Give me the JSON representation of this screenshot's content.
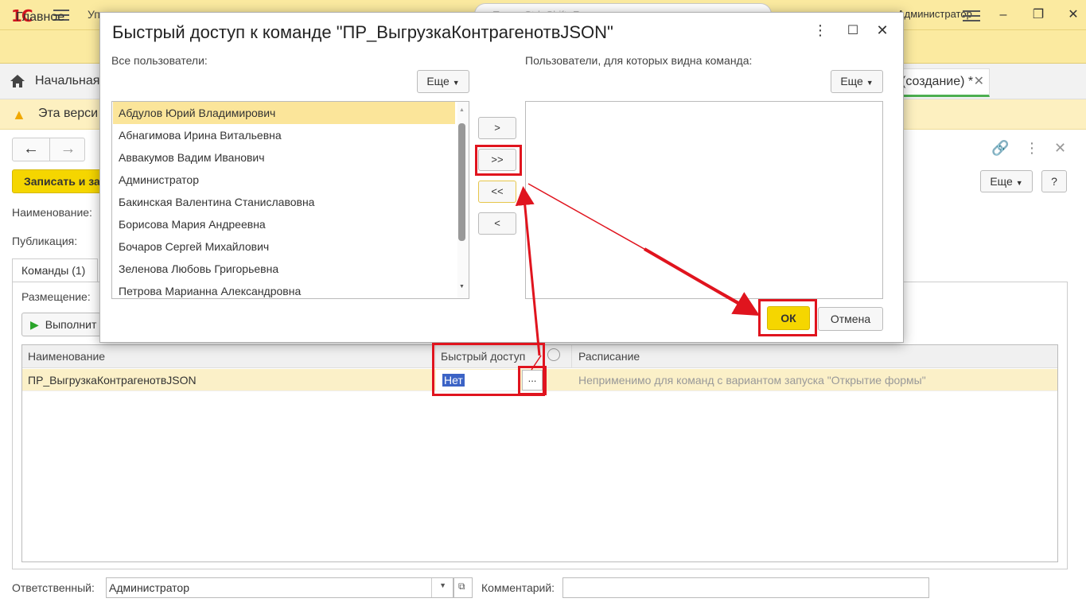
{
  "topbar": {
    "logo": "1С",
    "app_title": "Уп",
    "search_placeholder": "Поиск Ctrl+Shift+F",
    "user": "Администратор",
    "win_minimize": "–",
    "win_restore": "❐",
    "win_close": "✕"
  },
  "sections": {
    "main": "Главное"
  },
  "tabs": {
    "home": "Начальная",
    "active": "(создание) *",
    "active_close": "✕"
  },
  "warning": {
    "text": "Эта верси"
  },
  "form": {
    "nav_back": "←",
    "nav_forward": "→",
    "save_label": "Записать и за",
    "more_label": "Еще",
    "help_label": "?",
    "name_label": "Наименование:",
    "publication_label": "Публикация:",
    "commands_tab": "Команды (1)",
    "placement_label": "Размещение:",
    "run_label": "Выполнит",
    "grid": {
      "columns": [
        "Наименование",
        "Быстрый доступ",
        "Расписание"
      ],
      "rows": [
        {
          "name": "ПР_ВыгрузкаКонтрагенотвJSON",
          "quick_access": "Нет",
          "schedule": "Неприменимо для команд с вариантом запуска \"Открытие формы\""
        }
      ],
      "dots": "..."
    },
    "responsible_label": "Ответственный:",
    "responsible_value": "Администратор",
    "comment_label": "Комментарий:",
    "comment_value": ""
  },
  "dialog": {
    "title": "Быстрый доступ к команде \"ПР_ВыгрузкаКонтрагенотвJSON\"",
    "all_users_label": "Все пользователи:",
    "visible_users_label": "Пользователи, для которых видна команда:",
    "more_label": "Еще",
    "users": [
      "Абдулов Юрий Владимирович",
      "Абнагимова Ирина Витальевна",
      "Аввакумов Вадим Иванович",
      "Администратор",
      "Бакинская Валентина Станиславовна",
      "Борисова Мария Андреевна",
      "Бочаров Сергей Михайлович",
      "Зеленова Любовь Григорьевна",
      "Петрова Марианна Александровна"
    ],
    "btn_add": ">",
    "btn_add_all": ">>",
    "btn_remove_all": "<<",
    "btn_remove": "<",
    "ok_label": "ОК",
    "cancel_label": "Отмена"
  },
  "colors": {
    "accent_yellow": "#f5d600",
    "annotation_red": "#e0141e",
    "selection_blue": "#3b63c6"
  }
}
